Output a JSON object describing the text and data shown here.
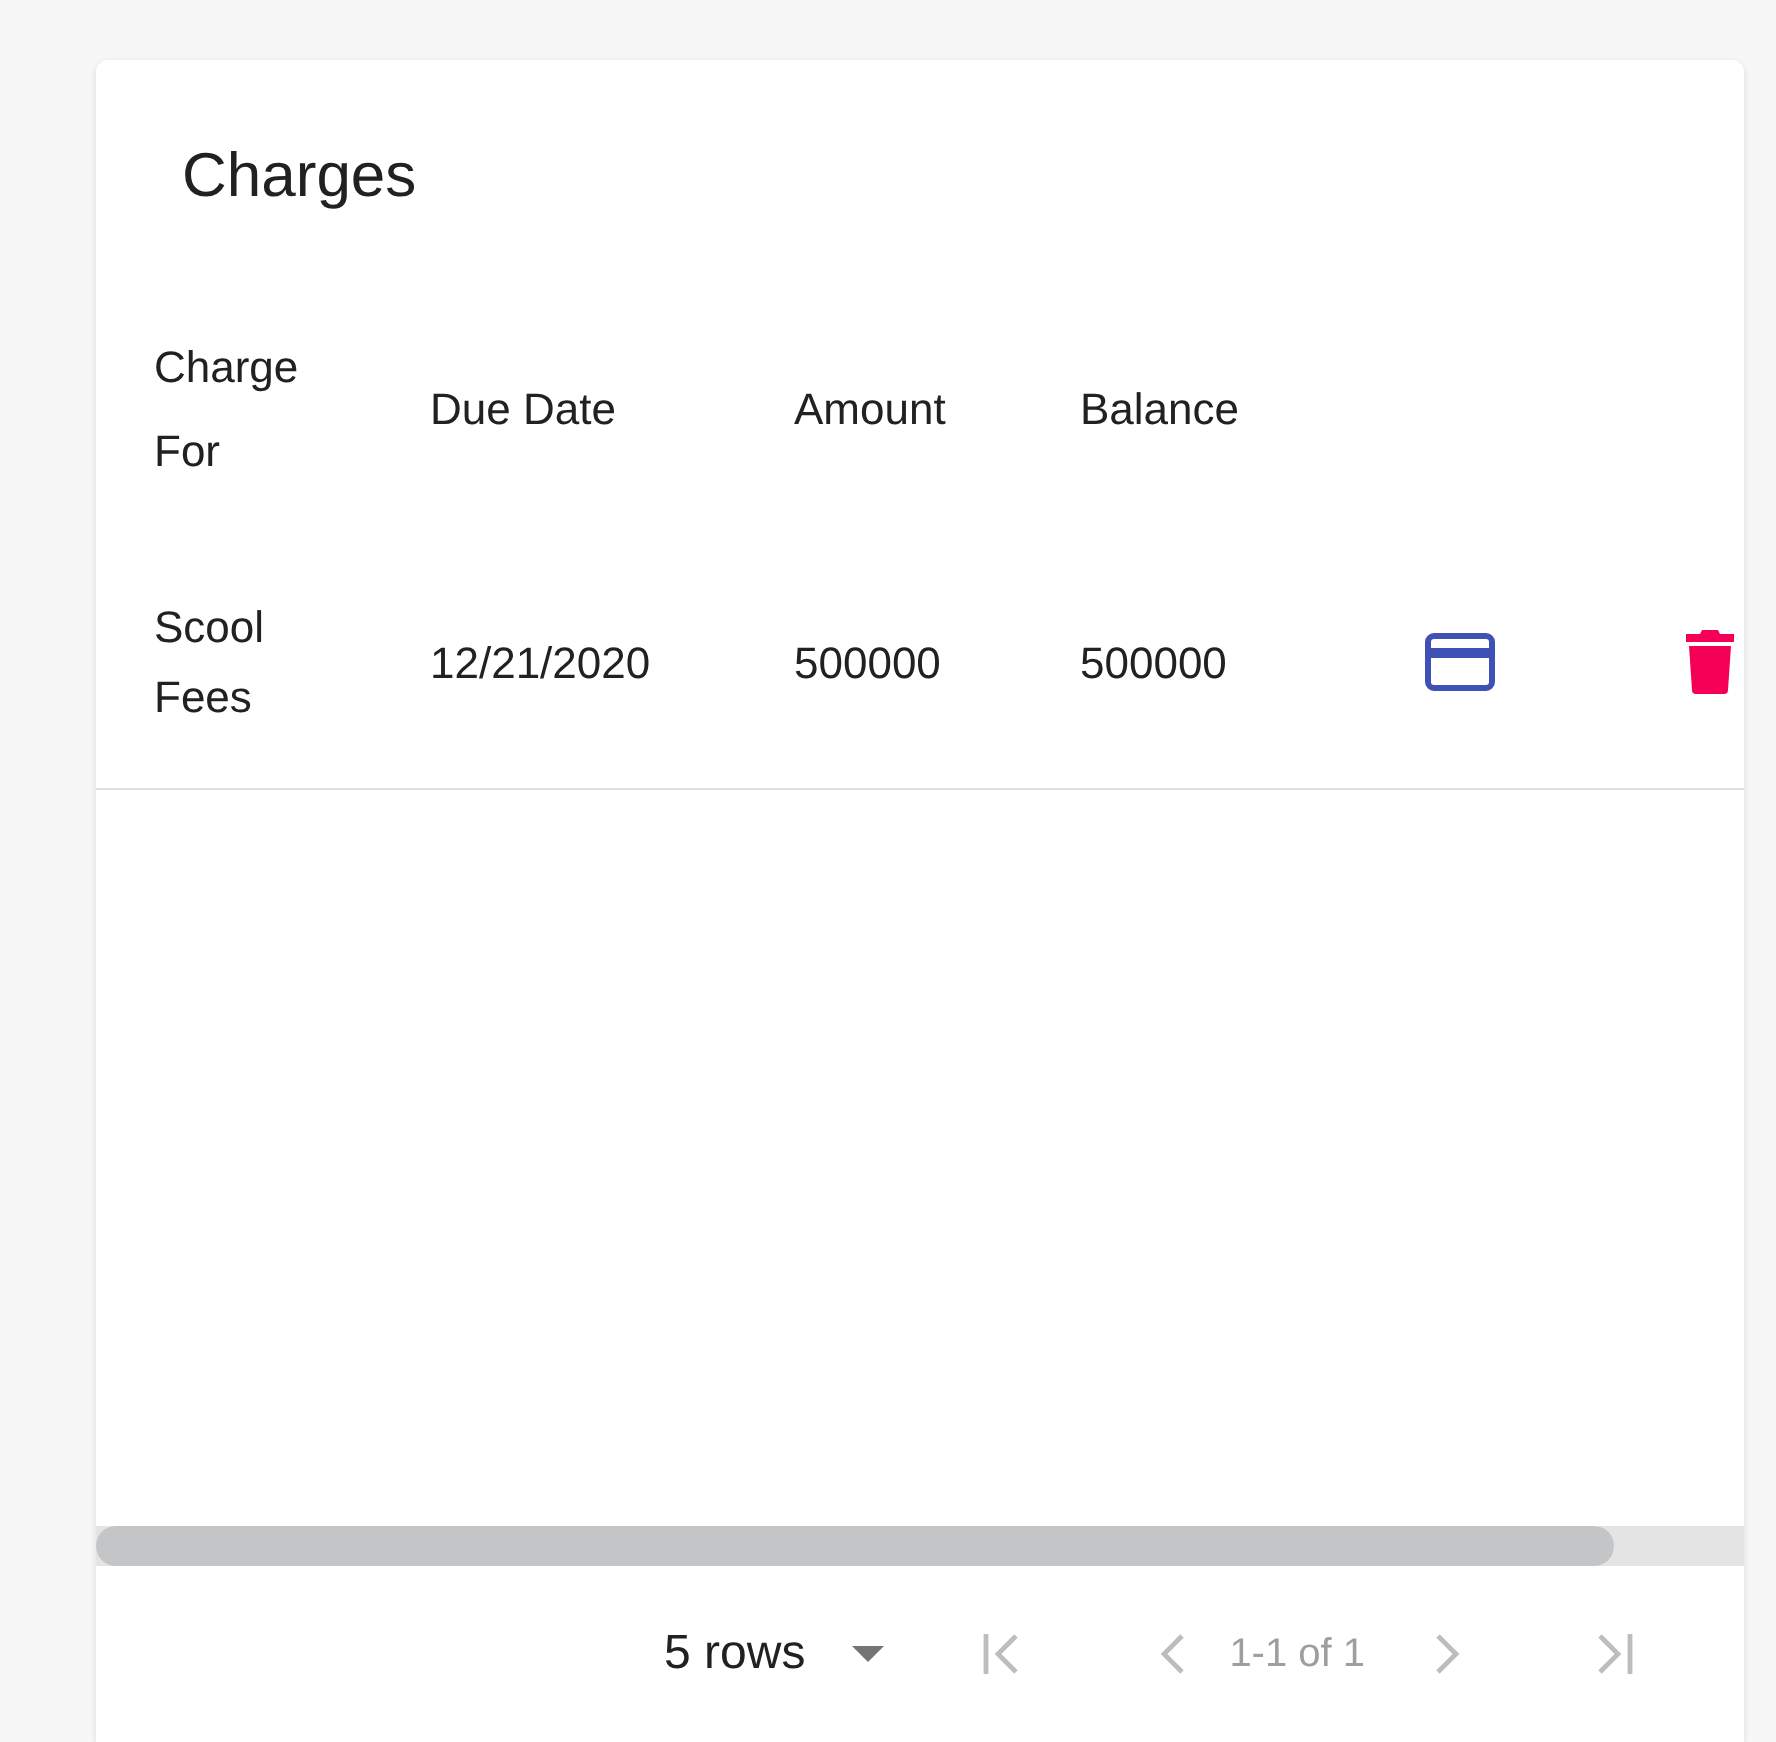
{
  "card": {
    "title": "Charges"
  },
  "table": {
    "columns": [
      "Charge For",
      "Due Date",
      "Amount",
      "Balance"
    ],
    "rows": [
      {
        "cells": [
          "Scool Fees",
          "12/21/2020",
          "500000",
          "500000"
        ],
        "actions": [
          {
            "kind": "pay"
          },
          {
            "kind": "delete"
          }
        ]
      }
    ]
  },
  "pagination": {
    "rows_per_page": "5 rows",
    "range": "1-1 of 1",
    "buttons": [
      {
        "kind": "first",
        "disabled": true
      },
      {
        "kind": "prev",
        "disabled": true
      },
      {
        "kind": "next",
        "disabled": true
      },
      {
        "kind": "last",
        "disabled": true
      }
    ]
  }
}
